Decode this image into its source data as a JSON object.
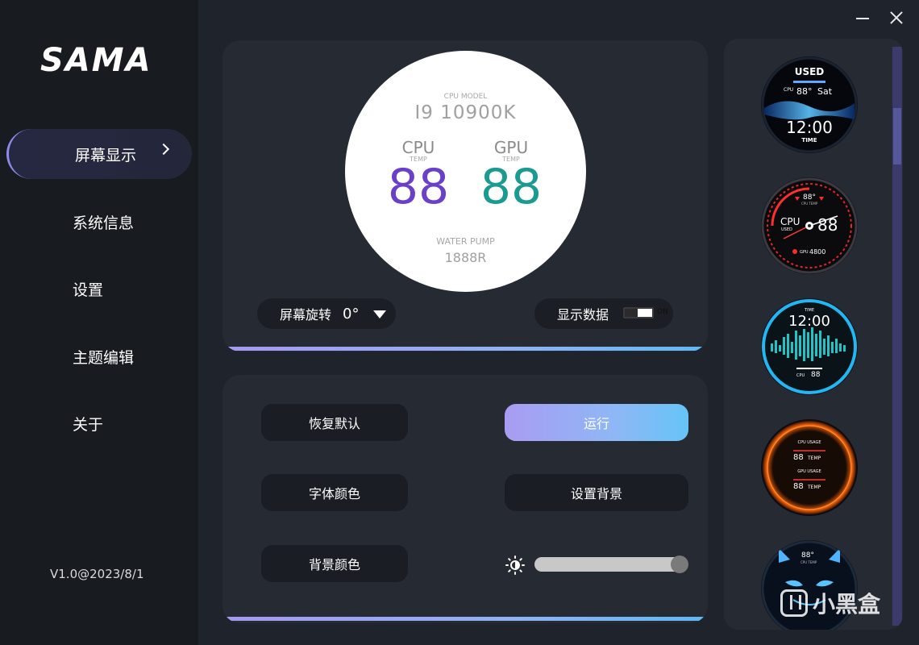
{
  "app": {
    "logo": "SAMA",
    "version": "V1.0@2023/8/1"
  },
  "sidebar": {
    "items": [
      {
        "label": "屏幕显示",
        "active": true
      },
      {
        "label": "系统信息",
        "active": false
      },
      {
        "label": "设置",
        "active": false
      },
      {
        "label": "主题编辑",
        "active": false
      },
      {
        "label": "关于",
        "active": false
      }
    ]
  },
  "preview": {
    "cpu_model_label": "CPU MODEL",
    "cpu_model": "I9 10900K",
    "cpu_label": "CPU",
    "gpu_label": "GPU",
    "temp_label": "TEMP",
    "cpu_value": "88",
    "gpu_value": "88",
    "pump_label": "WATER PUMP",
    "pump_value": "1888R",
    "cpu_color": "#6a40c9",
    "gpu_color": "#1a9a90"
  },
  "controls": {
    "rotate_label": "屏幕旋转",
    "rotate_value": "0°",
    "show_data_label": "显示数据",
    "toggle_label": "ON"
  },
  "buttons": {
    "restore": "恢复默认",
    "run": "运行",
    "font_color": "字体颜色",
    "set_background": "设置背景",
    "background_color": "背景颜色"
  },
  "brightness": {
    "level": 1.0
  },
  "themes": {
    "t1": {
      "used": "USED",
      "cpu": "CPU",
      "temp": "88°",
      "day": "Sat",
      "time": "12:00",
      "time_label": "TIME"
    },
    "t2": {
      "top": "88°",
      "top_sub": "CPU TEMP",
      "cpu": "CPU",
      "used": "USED",
      "value": "88",
      "gpu": "GPU",
      "rpm": "4800"
    },
    "t3": {
      "time_label": "TIME",
      "time": "12:00",
      "cpu": "CPU",
      "value": "88"
    },
    "t4": {
      "cpu_usage": "CPU USAGE",
      "gpu_usage": "GPU USAGE",
      "v1": "88",
      "v2": "88",
      "temp": "TEMP"
    },
    "t5": {
      "value": "88°",
      "sub": "CPU TEMP"
    }
  },
  "watermark": {
    "text": "小黑盒"
  },
  "colors": {
    "accent": "#8f8ae8",
    "panel": "#262a33",
    "sidebar": "#181b20"
  }
}
